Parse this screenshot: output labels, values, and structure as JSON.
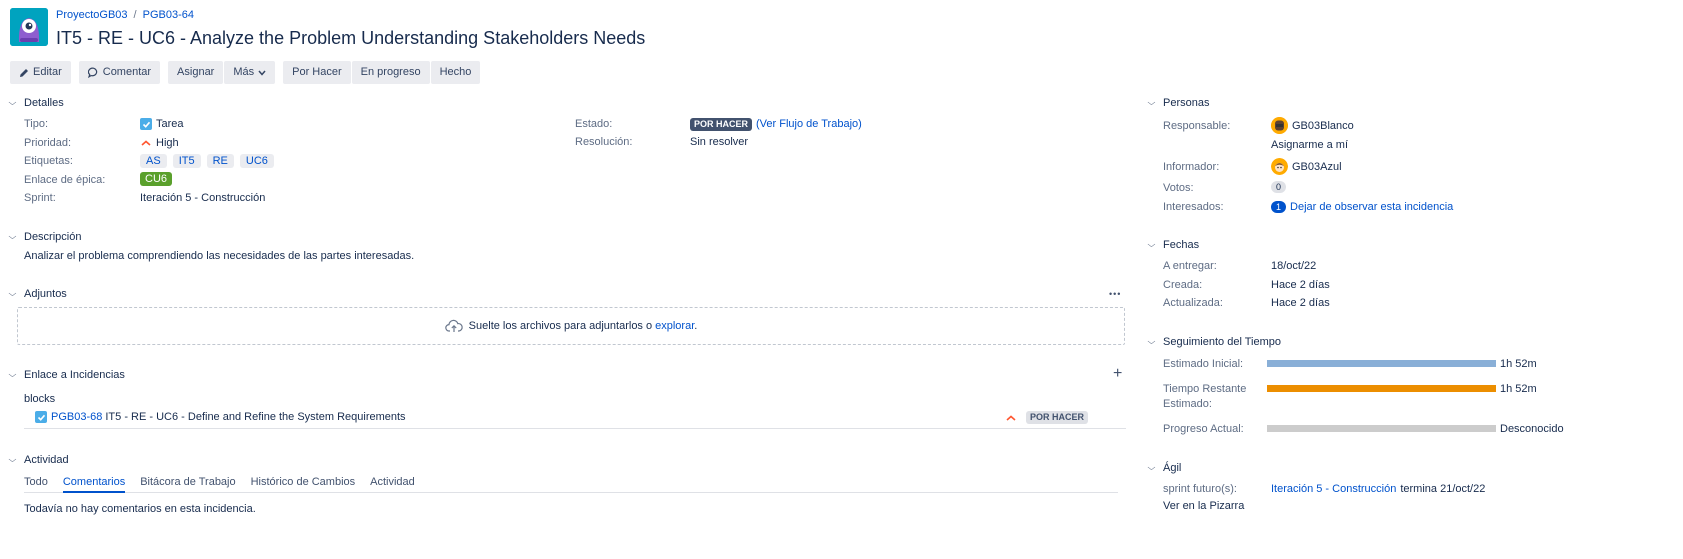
{
  "breadcrumb": {
    "project": "ProyectoGB03",
    "separator": "/",
    "issue_key": "PGB03-64"
  },
  "issue_title": "IT5 - RE - UC6 - Analyze the Problem Understanding Stakeholders Needs",
  "toolbar": {
    "edit": "Editar",
    "comment": "Comentar",
    "assign": "Asignar",
    "more": "Más",
    "todo": "Por Hacer",
    "in_progress": "En progreso",
    "done": "Hecho"
  },
  "details": {
    "heading": "Detalles",
    "type_label": "Tipo:",
    "type_value": "Tarea",
    "priority_label": "Prioridad:",
    "priority_value": "High",
    "labels_label": "Etiquetas:",
    "labels": [
      "AS",
      "IT5",
      "RE",
      "UC6"
    ],
    "epic_label": "Enlace de épica:",
    "epic_value": "CU6",
    "sprint_label": "Sprint:",
    "sprint_value": "Iteración 5 - Construcción",
    "status_label": "Estado:",
    "status_value": "POR HACER",
    "workflow_link": "(Ver Flujo de Trabajo)",
    "resolution_label": "Resolución:",
    "resolution_value": "Sin resolver"
  },
  "description": {
    "heading": "Descripción",
    "text": "Analizar el problema comprendiendo las necesidades de las partes interesadas."
  },
  "attachments": {
    "heading": "Adjuntos",
    "more": "•••",
    "drop_text": "Suelte los archivos para adjuntarlos o",
    "browse": "explorar",
    "period": "."
  },
  "links": {
    "heading": "Enlace a Incidencias",
    "add": "+",
    "relation": "blocks",
    "item": {
      "key": "PGB03-68",
      "summary": "IT5 - RE - UC6 - Define and Refine the System Requirements",
      "status": "POR HACER"
    }
  },
  "activity": {
    "heading": "Actividad",
    "tabs": [
      "Todo",
      "Comentarios",
      "Bitácora de Trabajo",
      "Histórico de Cambios",
      "Actividad"
    ],
    "active_tab": "Comentarios",
    "empty": "Todavía no hay comentarios en esta incidencia."
  },
  "people": {
    "heading": "Personas",
    "assignee_label": "Responsable:",
    "assignee": "GB03Blanco",
    "assign_me": "Asignarme a mí",
    "reporter_label": "Informador:",
    "reporter": "GB03Azul",
    "votes_label": "Votos:",
    "votes": "0",
    "watchers_label": "Interesados:",
    "watchers": "1",
    "unwatch": "Dejar de observar esta incidencia"
  },
  "dates": {
    "heading": "Fechas",
    "due_label": "A entregar:",
    "due": "18/oct/22",
    "created_label": "Creada:",
    "created": "Hace 2 días",
    "updated_label": "Actualizada:",
    "updated": "Hace 2 días"
  },
  "time": {
    "heading": "Seguimiento del Tiempo",
    "original_label": "Estimado Inicial:",
    "original": "1h 52m",
    "original_fraction": 1.0,
    "remaining_label_1": "Tiempo Restante",
    "remaining_label_2": "Estimado:",
    "remaining": "1h 52m",
    "remaining_fraction": 1.0,
    "logged_label": "Progreso Actual:",
    "logged": "Desconocido",
    "colors": {
      "original": "#89afd7",
      "remaining": "#ec8e00",
      "logged": "#cccccc"
    }
  },
  "agile": {
    "heading": "Ágil",
    "future_label": "sprint futuro(s):",
    "future_sprint": "Iteración 5 - Construcción",
    "ends": "termina 21/oct/22",
    "board_link": "Ver en la Pizarra"
  }
}
